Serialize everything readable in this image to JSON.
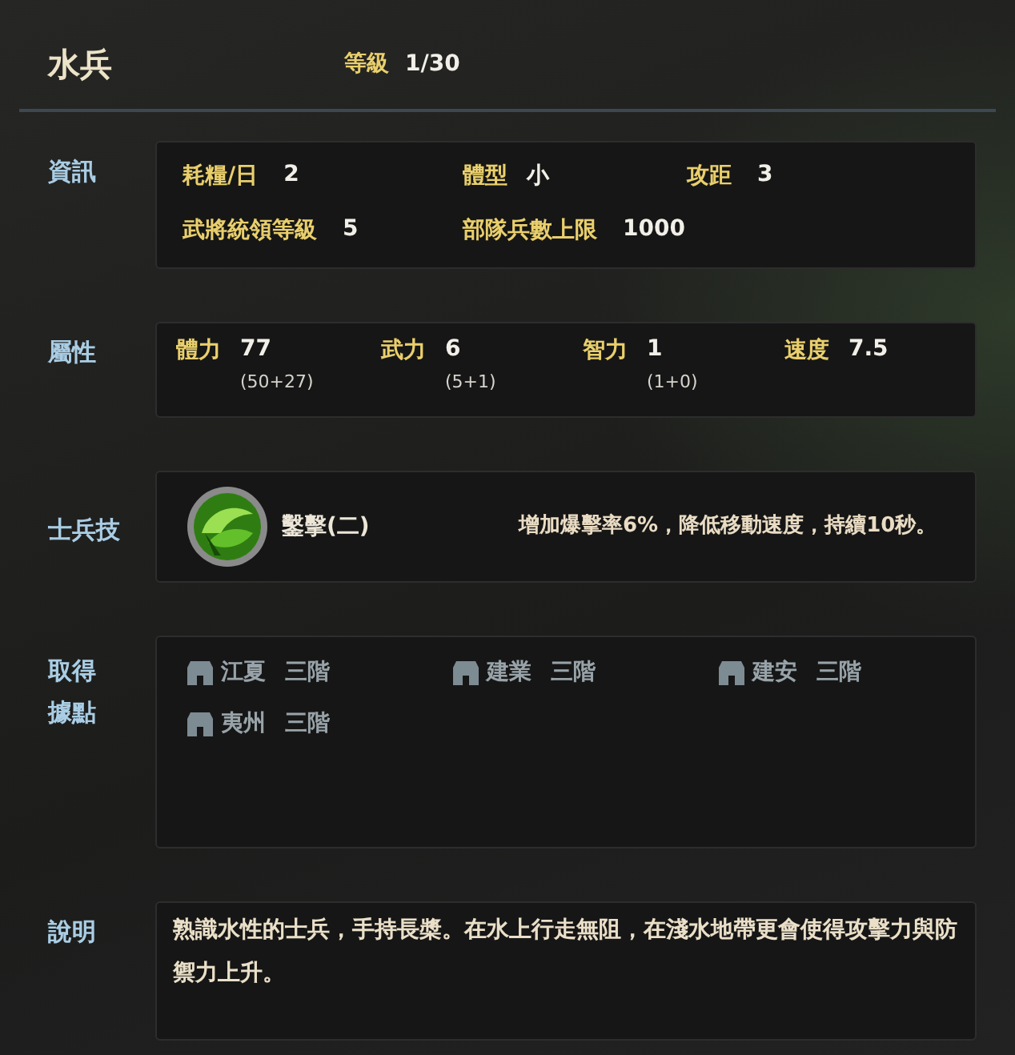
{
  "header": {
    "name": "水兵",
    "level_label": "等級",
    "level_value": "1/30"
  },
  "info": {
    "label": "資訊",
    "items": [
      {
        "label": "耗糧/日",
        "value": "2"
      },
      {
        "label": "體型",
        "value": "小"
      },
      {
        "label": "攻距",
        "value": "3"
      },
      {
        "label": "武將統領等級",
        "value": "5"
      },
      {
        "label": "部隊兵數上限",
        "value": "1000"
      }
    ]
  },
  "attributes": {
    "label": "屬性",
    "items": [
      {
        "label": "體力",
        "value": "77",
        "detail": "(50+27)"
      },
      {
        "label": "武力",
        "value": "6",
        "detail": "(5+1)"
      },
      {
        "label": "智力",
        "value": "1",
        "detail": "(1+0)"
      },
      {
        "label": "速度",
        "value": "7.5"
      }
    ]
  },
  "skill": {
    "label": "士兵技",
    "name": "鑿擊(二)",
    "description": "增加爆擊率6%，降低移動速度，持續10秒。"
  },
  "bases": {
    "label": "取得據點",
    "items": [
      {
        "name": "江夏",
        "grade": "三階"
      },
      {
        "name": "建業",
        "grade": "三階"
      },
      {
        "name": "建安",
        "grade": "三階"
      },
      {
        "name": "夷州",
        "grade": "三階"
      }
    ]
  },
  "description": {
    "label": "說明",
    "text": "熟識水性的士兵，手持長槳。在水上行走無阻，在淺水地帶更會使得攻擊力與防禦力上升。"
  }
}
